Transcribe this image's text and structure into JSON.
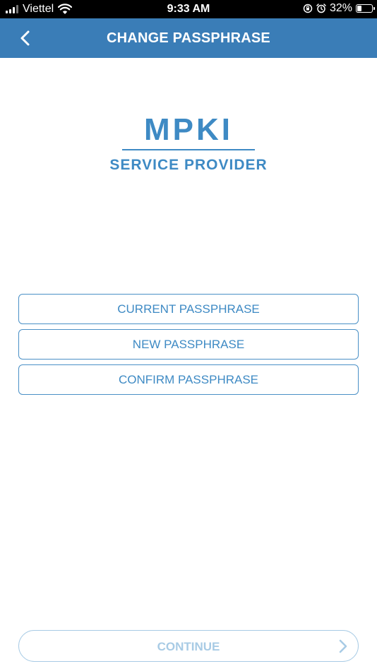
{
  "status_bar": {
    "carrier": "Viettel",
    "time": "9:33 AM",
    "battery_percent": "32%",
    "battery_level": 0.32,
    "icons": [
      "signal-icon",
      "wifi-icon",
      "orientation-lock-icon",
      "alarm-icon",
      "battery-icon"
    ]
  },
  "header": {
    "title": "CHANGE PASSPHRASE",
    "back_icon": "chevron-left-icon",
    "background": "#3a7db7"
  },
  "logo": {
    "main": "MPKI",
    "sub": "SERVICE PROVIDER",
    "color": "#3e8ac4"
  },
  "form": {
    "current": {
      "placeholder": "CURRENT PASSPHRASE",
      "value": ""
    },
    "new": {
      "placeholder": "NEW PASSPHRASE",
      "value": ""
    },
    "confirm": {
      "placeholder": "CONFIRM PASSPHRASE",
      "value": ""
    }
  },
  "continue_button": {
    "label": "CONTINUE",
    "icon": "chevron-right-icon",
    "state": "disabled"
  }
}
